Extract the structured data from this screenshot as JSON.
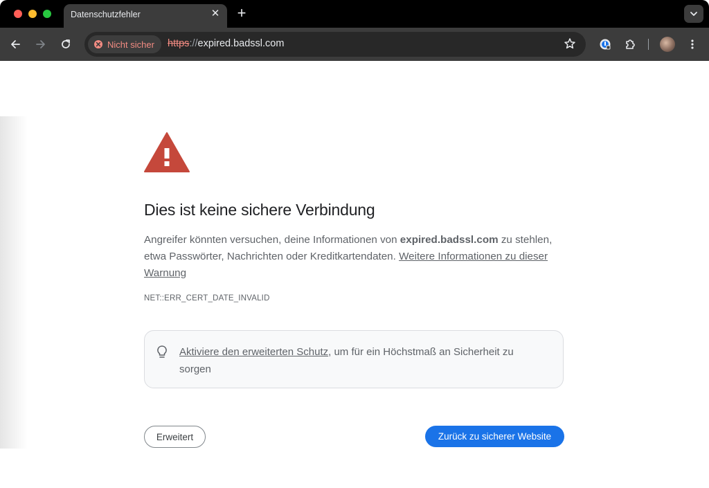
{
  "browser": {
    "tab": {
      "title": "Datenschutzfehler",
      "close_glyph": "✕"
    },
    "new_tab_glyph": "+",
    "tab_search_glyph": "⌄",
    "omnibox": {
      "security_chip_label": "Nicht sicher",
      "url_scheme": "https",
      "url_separator": "://",
      "url_host": "expired.badssl.com"
    },
    "icons": [
      "back-icon",
      "forward-icon",
      "reload-icon",
      "not-secure-icon",
      "star-icon",
      "password-manager-icon",
      "extensions-icon",
      "avatar",
      "more-menu-icon"
    ]
  },
  "interstitial": {
    "heading": "Dies ist keine sichere Verbindung",
    "body_prefix": "Angreifer könnten versuchen, deine Informationen von ",
    "body_host": "expired.badssl.com",
    "body_middle": " zu stehlen, etwa Passwörter, Nachrichten oder Kreditkartendaten. ",
    "learn_more_link": "Weitere Informationen zu dieser Warnung",
    "error_code": "NET::ERR_CERT_DATE_INVALID",
    "tip": {
      "link": "Aktiviere den erweiterten Schutz",
      "text": ", um für ein Höchstmaß an Sicherheit zu sorgen"
    },
    "advanced_button": "Erweitert",
    "back_button": "Zurück zu sicherer Website"
  },
  "colors": {
    "warning_red": "#c5483b",
    "primary_blue": "#1a73e8",
    "not_secure_red": "#f28b82"
  }
}
